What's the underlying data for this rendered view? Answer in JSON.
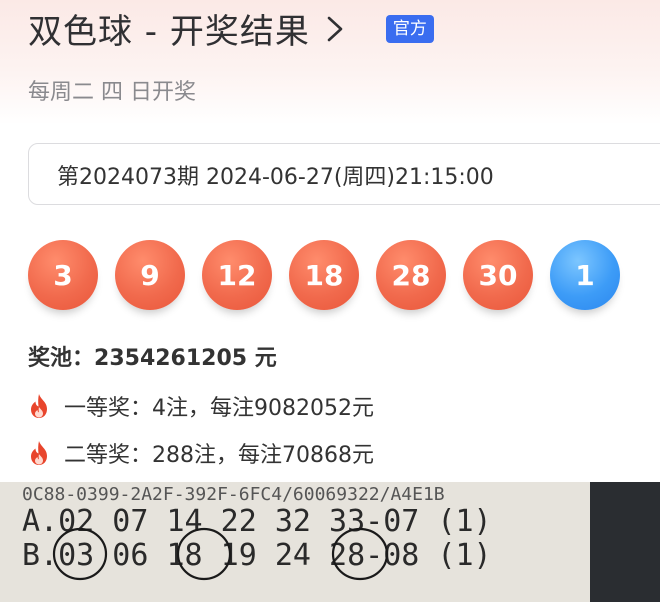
{
  "header": {
    "title": "双色球 - 开奖结果",
    "badge": "官方",
    "subtitle": "每周二 四 日开奖"
  },
  "issue_select": {
    "value": "第2024073期 2024-06-27(周四)21:15:00"
  },
  "balls": {
    "red": [
      "3",
      "9",
      "12",
      "18",
      "28",
      "30"
    ],
    "blue": [
      "1"
    ]
  },
  "pool": {
    "label": "奖池：",
    "amount": "2354261205 元"
  },
  "prizes": [
    {
      "text": "一等奖：4注，每注9082052元"
    },
    {
      "text": "二等奖：288注，每注70868元"
    }
  ],
  "ticket": {
    "serial": "0C88-0399-2A2F-392F-6FC4/60069322/A4E1B",
    "line_a": "A.02 07 14 22 32 33-07 (1)",
    "line_b": "B.03 06 18 19 24 28-08 (1)"
  },
  "colors": {
    "red_ball": "#f16a4d",
    "blue_ball": "#3d9cf7",
    "badge": "#3a6df0",
    "fire": "#e8452c"
  }
}
